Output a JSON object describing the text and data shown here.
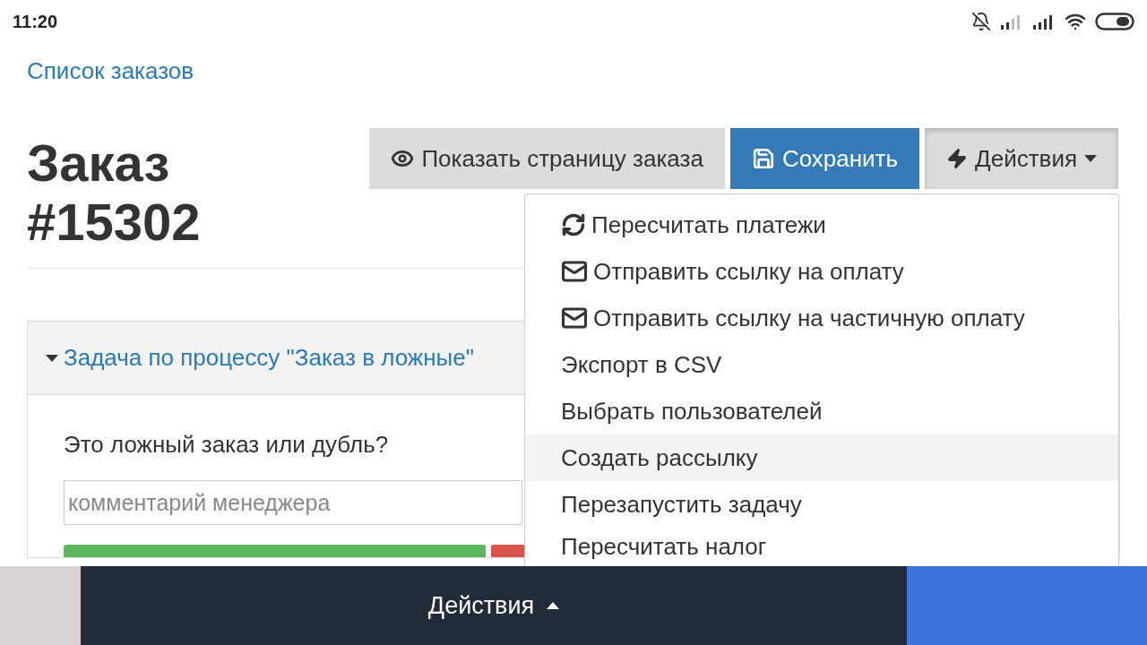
{
  "status_bar": {
    "time": "11:20"
  },
  "breadcrumb": "Список заказов",
  "title_lines": [
    "Заказ",
    "#15302"
  ],
  "toolbar": [
    {
      "kind": "view",
      "label": "Показать страницу заказа"
    },
    {
      "kind": "save",
      "label": "Сохранить"
    },
    {
      "kind": "actions",
      "label": "Действия",
      "expanded": true
    }
  ],
  "dropdown": [
    {
      "kind": "recalc",
      "label": "Пересчитать платежи",
      "selected": false
    },
    {
      "kind": "mail",
      "label": "Отправить ссылку на оплату",
      "selected": false
    },
    {
      "kind": "mail",
      "label": "Отправить ссылку на частичную оплату",
      "selected": false
    },
    {
      "kind": "plain",
      "label": "Экспорт в CSV",
      "selected": false
    },
    {
      "kind": "plain",
      "label": "Выбрать пользователей",
      "selected": false
    },
    {
      "kind": "plain",
      "label": "Создать рассылку",
      "selected": true
    },
    {
      "kind": "plain",
      "label": "Перезапустить задачу",
      "selected": false
    },
    {
      "kind": "plain",
      "label": "Пересчитать налог",
      "selected": false
    }
  ],
  "task_panel": {
    "title": "Задача по процессу \"Заказ в ложные\"",
    "expanded": true,
    "question": "Это ложный заказ или дубль?",
    "comment": {
      "placeholder": "комментарий менеджера"
    }
  },
  "bottom_bar": {
    "label": "Действия",
    "expanded": false
  }
}
